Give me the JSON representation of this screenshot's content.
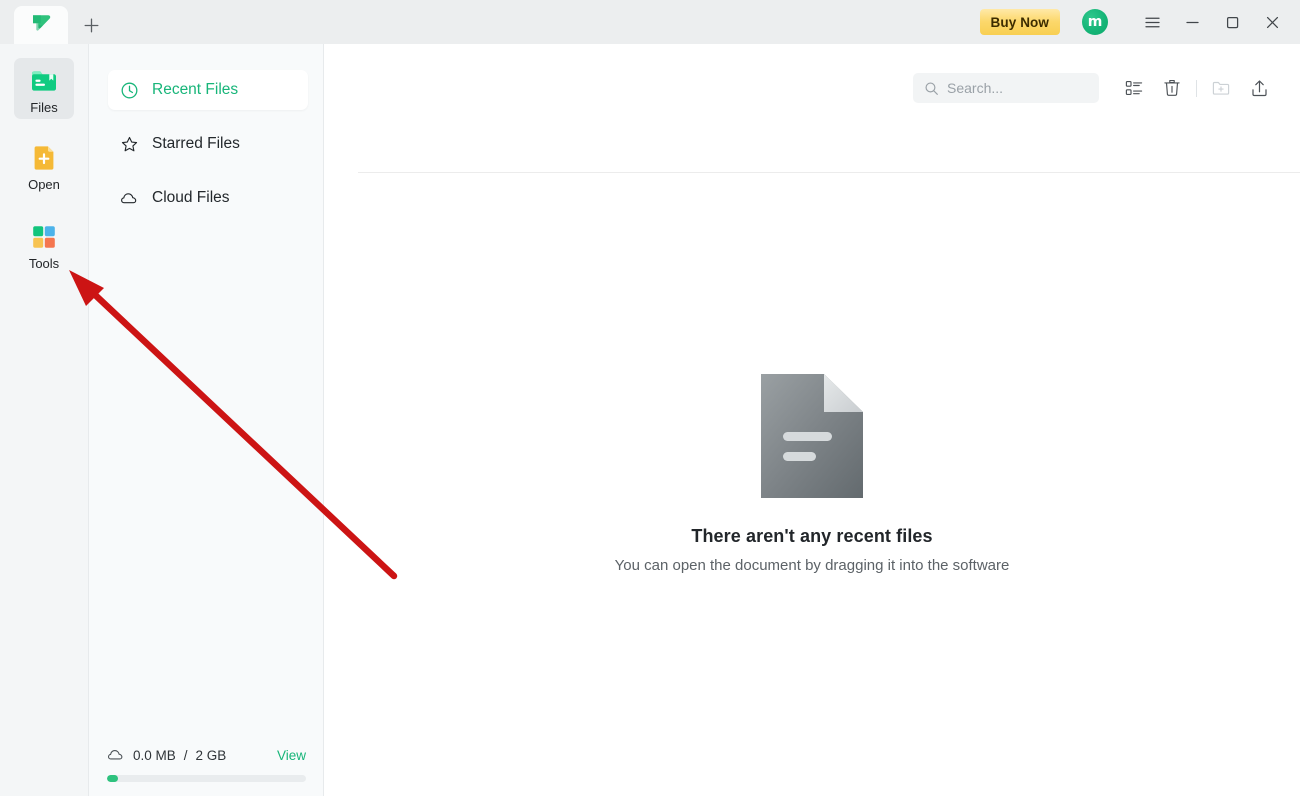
{
  "window": {
    "tab_logo_icon": "app-logo-icon",
    "new_tab_icon": "plus-icon",
    "buy_now_label": "Buy Now",
    "avatar_initial": "m",
    "menu_icon": "hamburger-menu-icon",
    "minimize_icon": "minimize-icon",
    "maximize_icon": "maximize-icon",
    "close_icon": "close-icon"
  },
  "rail": {
    "items": [
      {
        "label": "Files",
        "icon": "folder-bookmark-icon",
        "selected": true
      },
      {
        "label": "Open",
        "icon": "document-plus-icon",
        "selected": false
      },
      {
        "label": "Tools",
        "icon": "four-squares-grid-icon",
        "selected": false
      }
    ]
  },
  "sidebar": {
    "items": [
      {
        "label": "Recent Files",
        "icon": "clock-icon",
        "active": true
      },
      {
        "label": "Starred Files",
        "icon": "star-icon",
        "active": false
      },
      {
        "label": "Cloud Files",
        "icon": "cloud-icon",
        "active": false
      }
    ],
    "storage": {
      "icon": "cloud-icon",
      "used": "0.0 MB",
      "separator": "/",
      "total": "2 GB",
      "view_label": "View",
      "progress_percent": 1
    }
  },
  "toolbar": {
    "search_placeholder": "Search...",
    "search_value": "",
    "search_icon": "search-icon",
    "list_view_icon": "list-view-icon",
    "trash_icon": "trash-icon",
    "new_folder_icon": "new-folder-icon",
    "upload_icon": "upload-icon"
  },
  "empty_state": {
    "icon": "document-placeholder-icon",
    "title": "There aren't any recent files",
    "subtitle": "You can open the document by dragging it into the software"
  },
  "annotation": {
    "arrow_color": "#cc1414",
    "arrow_target": "Tools"
  },
  "colors": {
    "accent_green": "#17b579",
    "buy_now_gold": "#f8cf52",
    "annotation_red": "#cc1414",
    "titlebar_bg": "#eceeef",
    "rail_bg": "#f4f6f7",
    "sidebar_bg": "#f8fafb"
  }
}
